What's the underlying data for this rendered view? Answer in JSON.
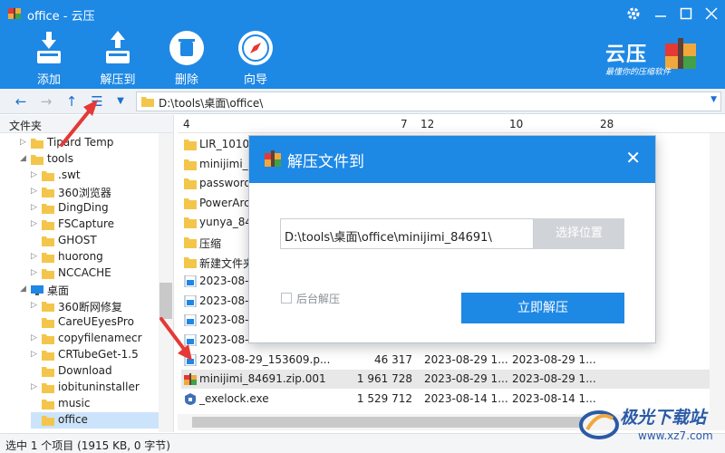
{
  "window": {
    "title": "office - 云压"
  },
  "toolbar": {
    "add_label": "添加",
    "extract_label": "解压到",
    "delete_label": "删除",
    "wizard_label": "向导"
  },
  "brand": {
    "name": "云压",
    "slogan": "最懂你的压缩软件"
  },
  "address": {
    "path": "D:\\tools\\桌面\\office\\"
  },
  "tree": {
    "header": "文件夹",
    "items": [
      {
        "label": "Tipard Temp",
        "expander": "▷"
      },
      {
        "label": "tools",
        "expander": "◢"
      },
      {
        "label": ".swt",
        "expander": "▷"
      },
      {
        "label": "360浏览器",
        "expander": "▷"
      },
      {
        "label": "DingDing",
        "expander": "▷"
      },
      {
        "label": "FSCapture",
        "expander": "▷"
      },
      {
        "label": "GHOST",
        "expander": ""
      },
      {
        "label": "huorong",
        "expander": "▷"
      },
      {
        "label": "NCCACHE",
        "expander": "▷"
      },
      {
        "label": "桌面",
        "expander": "◢"
      },
      {
        "label": "360断网修复",
        "expander": "▷"
      },
      {
        "label": "CareUEyesPro",
        "expander": ""
      },
      {
        "label": "copyfilenamecr",
        "expander": "▷"
      },
      {
        "label": "CRTubeGet-1.5",
        "expander": "▷"
      },
      {
        "label": "Download",
        "expander": ""
      },
      {
        "label": "iobituninstaller",
        "expander": "▷"
      },
      {
        "label": "music",
        "expander": ""
      },
      {
        "label": "office",
        "expander": ""
      }
    ]
  },
  "list": {
    "headers": {
      "name": "4",
      "size": "7",
      "modified": "12",
      "created": "10",
      "extra": "28"
    },
    "rows": [
      {
        "name": "LIR_1010",
        "size": "",
        "modified": "",
        "created": ""
      },
      {
        "name": "minijimi_8",
        "size": "",
        "modified": "",
        "created": ""
      },
      {
        "name": "password",
        "size": "",
        "modified": "",
        "created": ""
      },
      {
        "name": "PowerArc",
        "size": "",
        "modified": "",
        "created": ""
      },
      {
        "name": "yunya_845",
        "size": "",
        "modified": "",
        "created": ""
      },
      {
        "name": "压缩",
        "size": "",
        "modified": "",
        "created": ""
      },
      {
        "name": "新建文件夹",
        "size": "",
        "modified": "",
        "created": ""
      },
      {
        "name": "2023-08-2",
        "size": "",
        "modified": "",
        "created": ""
      },
      {
        "name": "2023-08-2",
        "size": "",
        "modified": "",
        "created": ""
      },
      {
        "name": "2023-08-2",
        "size": "",
        "modified": "",
        "created": ""
      },
      {
        "name": "2023-08-2",
        "size": "",
        "modified": "",
        "created": ""
      },
      {
        "name": "2023-08-29_153609.p...",
        "size": "46 317",
        "modified": "2023-08-29 1...",
        "created": "2023-08-29 1..."
      },
      {
        "name": "minijimi_84691.zip.001",
        "size": "1 961 728",
        "modified": "2023-08-29 1...",
        "created": "2023-08-29 1..."
      },
      {
        "name": "_exelock.exe",
        "size": "1 529 712",
        "modified": "2023-08-14 1...",
        "created": "2023-08-14 1..."
      }
    ]
  },
  "status": {
    "text": "选中 1 个项目 (1915 KB, 0 字节)"
  },
  "dialog": {
    "title": "解压文件到",
    "path_value": "D:\\tools\\桌面\\office\\minijimi_84691\\",
    "choose_label": "选择位置",
    "background_label": "后台解压",
    "extract_now_label": "立即解压"
  },
  "watermark": {
    "big": "极光下载站",
    "small": "www.xz7.com"
  },
  "colors": {
    "accent": "#1e88e5",
    "folder": "#f3c64b",
    "arrow": "#e53935"
  }
}
